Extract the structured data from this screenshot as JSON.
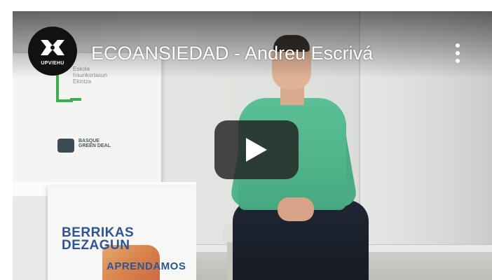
{
  "video": {
    "title": "ECOANSIEDAD - Andreu Escrivá",
    "channel_label": "UPV/EHU"
  },
  "scene": {
    "banner_text": "Eskola Iraunkortasun Ekintza",
    "banner_logo_text": "BASQUE GREEN DEAL",
    "box_text_line1": "BERRIKAS",
    "box_text_line2": "DEZAGUN",
    "box_text_line3": "APRENDAMOS"
  },
  "controls": {
    "play_icon": "play-icon",
    "menu_icon": "more-vert-icon"
  },
  "colors": {
    "play_button_bg": "#212121",
    "title_color": "#ffffff",
    "shirt": "#5bbf95",
    "box_text": "#2d5596"
  }
}
